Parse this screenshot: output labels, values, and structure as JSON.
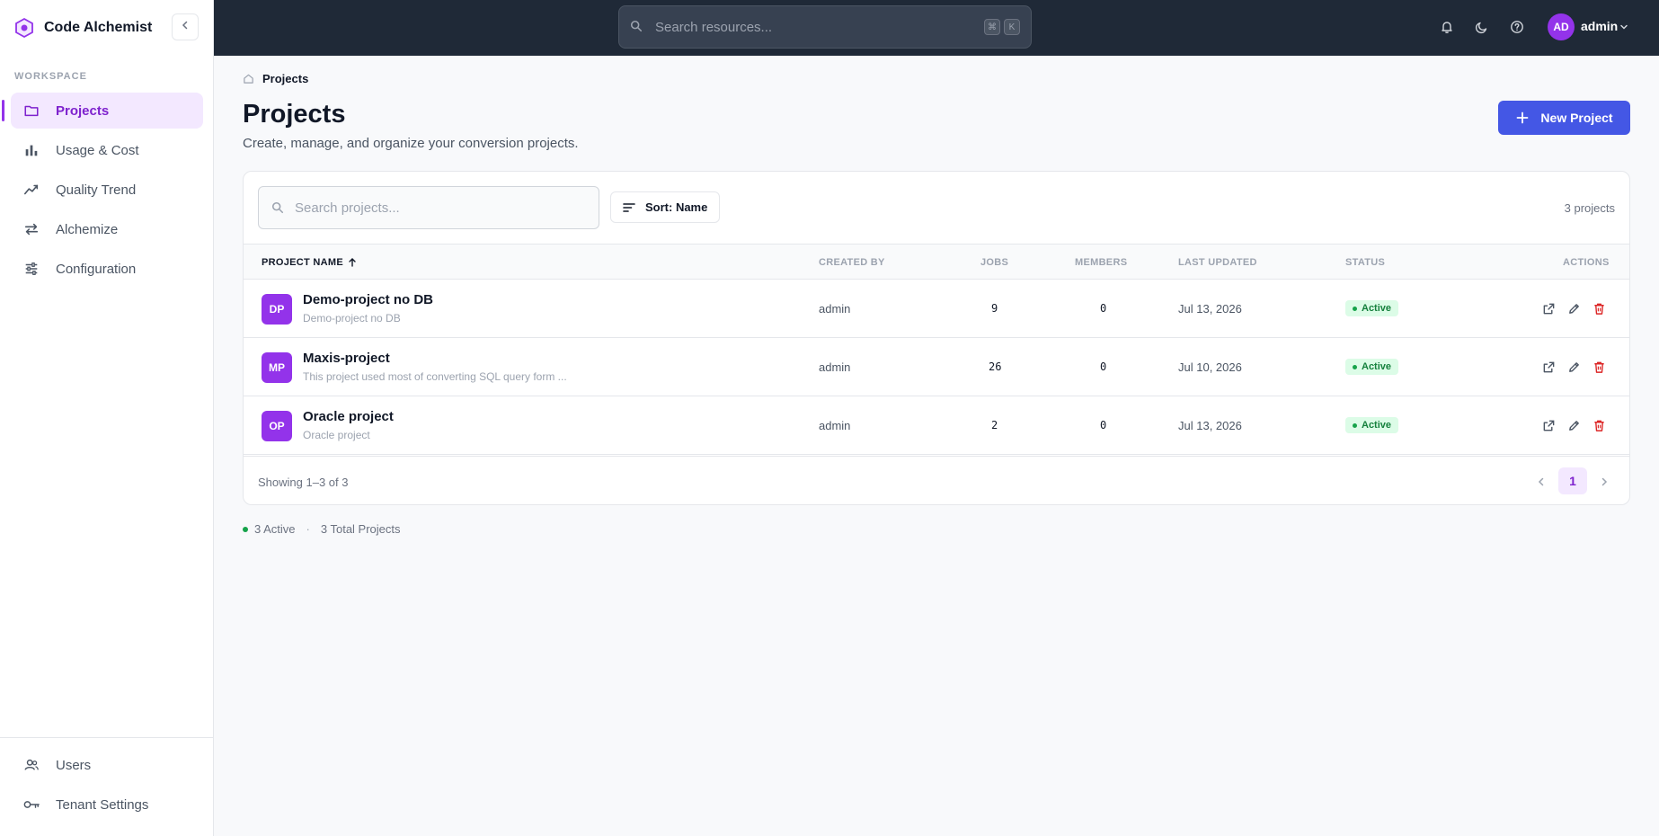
{
  "app": {
    "name": "Code Alchemist"
  },
  "sidebar": {
    "section_label": "WORKSPACE",
    "items": [
      {
        "label": "Projects",
        "icon": "folder-icon",
        "active": true
      },
      {
        "label": "Usage & Cost",
        "icon": "bar-chart-icon",
        "active": false
      },
      {
        "label": "Quality Trend",
        "icon": "trend-icon",
        "active": false
      },
      {
        "label": "Alchemize",
        "icon": "swap-icon",
        "active": false
      },
      {
        "label": "Configuration",
        "icon": "sliders-icon",
        "active": false
      }
    ],
    "bottom_items": [
      {
        "label": "Users",
        "icon": "users-icon"
      },
      {
        "label": "Tenant Settings",
        "icon": "key-icon"
      }
    ]
  },
  "topbar": {
    "search_placeholder": "Search resources...",
    "shortcut": [
      "⌘",
      "K"
    ],
    "user_initials": "AD",
    "user_name": "admin"
  },
  "page": {
    "breadcrumb": "Projects",
    "title": "Projects",
    "subtitle": "Create, manage, and organize your conversion projects.",
    "new_button": "New Project"
  },
  "toolbar": {
    "search_placeholder": "Search projects...",
    "sort_label": "Sort: Name",
    "count_text": "3 projects"
  },
  "table": {
    "columns": [
      "PROJECT NAME",
      "CREATED BY",
      "JOBS",
      "MEMBERS",
      "LAST UPDATED",
      "STATUS",
      "ACTIONS"
    ],
    "rows": [
      {
        "initials": "DP",
        "name": "Demo-project no DB",
        "description": "Demo-project no DB",
        "created_by": "admin",
        "jobs": "9",
        "members": "0",
        "updated": "Jul 13, 2026",
        "status": "Active"
      },
      {
        "initials": "MP",
        "name": "Maxis-project",
        "description": "This project used most of converting SQL query form ...",
        "created_by": "admin",
        "jobs": "26",
        "members": "0",
        "updated": "Jul 10, 2026",
        "status": "Active"
      },
      {
        "initials": "OP",
        "name": "Oracle project",
        "description": "Oracle project",
        "created_by": "admin",
        "jobs": "2",
        "members": "0",
        "updated": "Jul 13, 2026",
        "status": "Active"
      }
    ]
  },
  "footer": {
    "showing": "Showing 1–3 of 3",
    "page": "1"
  },
  "summary": {
    "active": "3 Active",
    "separator": "·",
    "total": "3 Total Projects"
  },
  "colors": {
    "accent": "#9333ea",
    "primary_button": "#4457e5",
    "topbar": "#1f2937",
    "active_badge": "#15803d",
    "delete": "#dc2626"
  }
}
